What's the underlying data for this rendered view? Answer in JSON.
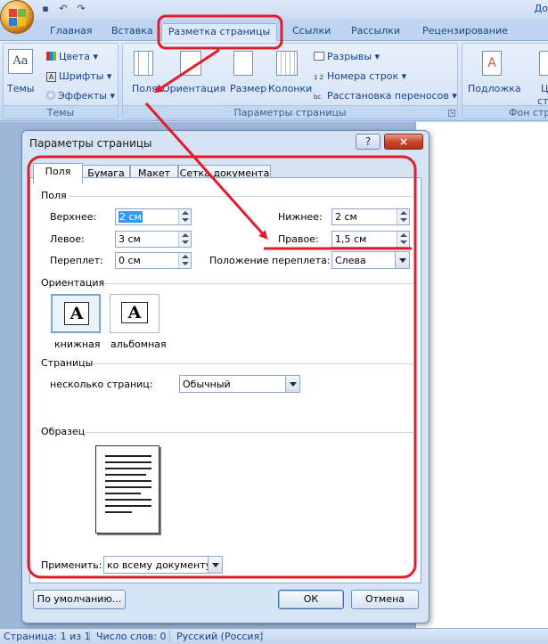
{
  "app": {
    "title_fragment": "До"
  },
  "ribbon": {
    "tabs": [
      "Главная",
      "Вставка",
      "Разметка страницы",
      "Ссылки",
      "Рассылки",
      "Рецензирование"
    ],
    "active_tab": "Разметка страницы",
    "group_themes": {
      "label": "Темы",
      "themes_button": "Темы",
      "colors": "Цвета",
      "fonts": "Шрифты",
      "effects": "Эффекты"
    },
    "group_page_setup": {
      "label": "Параметры страницы",
      "margins": "Поля",
      "orientation": "Ориентация",
      "size": "Размер",
      "columns": "Колонки",
      "breaks": "Разрывы",
      "line_numbers": "Номера строк",
      "hyphenation": "Расстановка переносов"
    },
    "group_background": {
      "label": "Фон стра",
      "watermark": "Подложка",
      "page_color_line1": "Цв",
      "page_color_line2": "стран"
    }
  },
  "dialog": {
    "title": "Параметры страницы",
    "help": "?",
    "close": "×",
    "tabs": [
      "Поля",
      "Бумага",
      "Макет",
      "Сетка документа"
    ],
    "active_tab": "Поля",
    "margins_section": "Поля",
    "top_label": "Верхнее:",
    "top_value": "2 см",
    "bottom_label": "Нижнее:",
    "bottom_value": "2 см",
    "left_label": "Левое:",
    "left_value": "3 см",
    "right_label": "Правое:",
    "right_value": "1,5 см",
    "gutter_label": "Переплет:",
    "gutter_value": "0 см",
    "gutter_pos_label": "Положение переплета:",
    "gutter_pos_value": "Слева",
    "orientation_section": "Ориентация",
    "portrait_label": "книжная",
    "landscape_label": "альбомная",
    "orientation_glyph": "A",
    "pages_section": "Страницы",
    "multiple_pages_label": "несколько страниц:",
    "multiple_pages_value": "Обычный",
    "sample_section": "Образец",
    "apply_label": "Применить:",
    "apply_value": "ко всему документу",
    "default_button": "По умолчанию...",
    "ok_button": "ОК",
    "cancel_button": "Отмена"
  },
  "statusbar": {
    "page": "Страница: 1 из 1",
    "words": "Число слов: 0",
    "language": "Русский (Россия)"
  },
  "colors": {
    "annotation_red": "#e01e2b",
    "ribbon_text": "#15428b"
  }
}
